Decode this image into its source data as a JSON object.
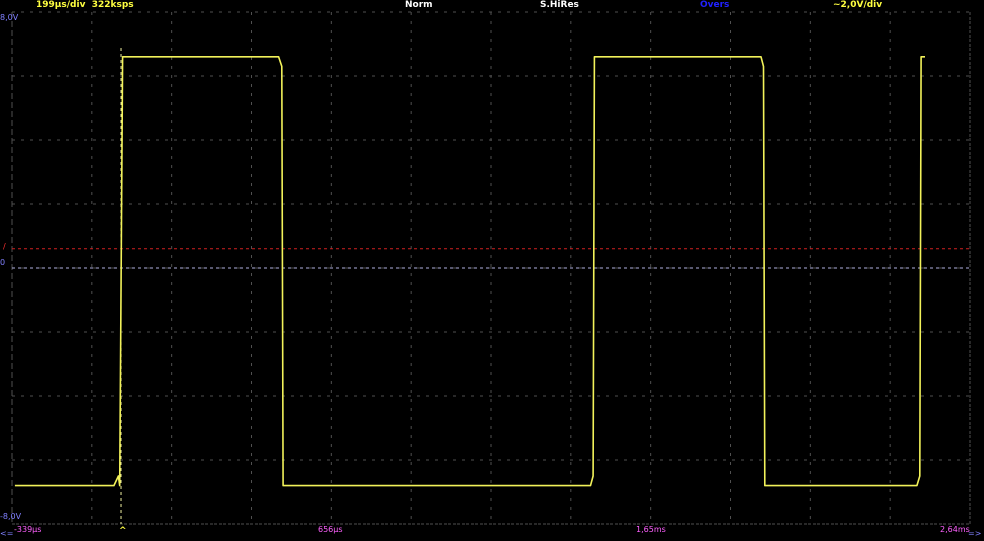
{
  "header": {
    "timebase": "199µs/div",
    "sample_rate": "322ksps",
    "trigger_mode": "Norm",
    "acq_mode": "S.HiRes",
    "oversampling": "Overs",
    "volts_div": "~2,0V/div"
  },
  "axis": {
    "top_label": "8,0V",
    "bottom_label": "-8,0V",
    "zero_label": "0",
    "trigger_marker": "/",
    "time_labels": [
      "-339µs",
      "656µs",
      "1,65ms",
      "2,64ms"
    ],
    "trigger_caret": "^",
    "left_arrow": "<=",
    "right_arrow": "=>"
  },
  "colors": {
    "background": "#000000",
    "trace": "#f2f25a",
    "grid": "#505050",
    "trigger_level": "#d02020",
    "zero_line": "#b0b0e0",
    "trigger_cursor": "#f0f0a0",
    "header_yellow": "#ffff40",
    "header_white": "#ffffff",
    "header_blue": "#2020ff",
    "axis_blue": "#8080ff",
    "time_pink": "#ff60ff"
  },
  "chart_data": {
    "type": "line",
    "xlabel": "",
    "ylabel": "",
    "xlim": [
      -339,
      2640
    ],
    "ylim": [
      -8.0,
      8.0
    ],
    "grid": true,
    "x_unit": "µs",
    "y_unit": "V",
    "trigger_level": 0.6,
    "trigger_time": 0,
    "series": [
      {
        "color": "#f2f25a",
        "x": [
          -330,
          -22,
          -8,
          -4,
          5,
          490,
          500,
          504,
          1460,
          1468,
          1472,
          1990,
          1998,
          2002,
          2475,
          2484,
          2488,
          2500
        ],
        "y": [
          -6.8,
          -6.8,
          -6.5,
          -6.8,
          6.6,
          6.6,
          6.3,
          -6.8,
          -6.8,
          -6.5,
          6.6,
          6.6,
          6.3,
          -6.8,
          -6.8,
          -6.5,
          6.6,
          6.6
        ]
      }
    ]
  }
}
